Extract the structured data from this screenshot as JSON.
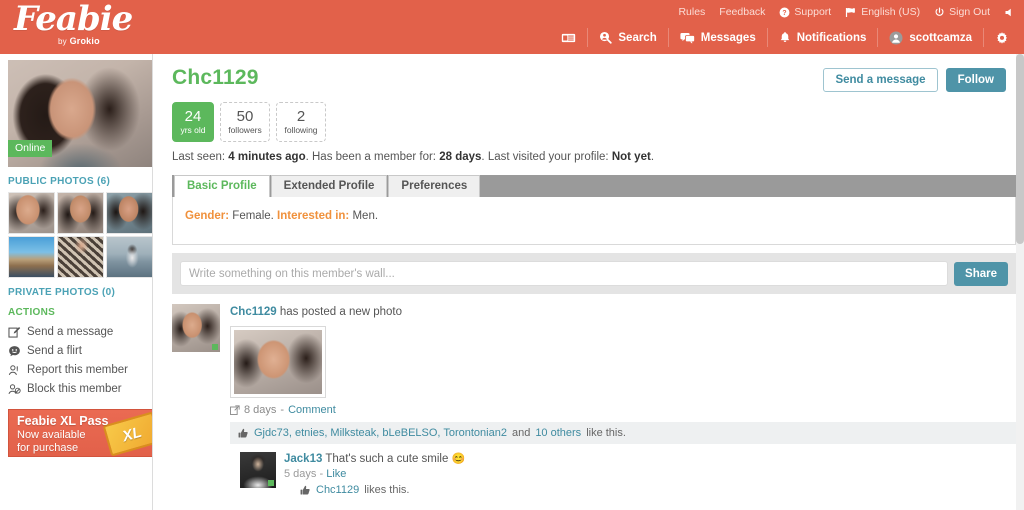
{
  "brand": {
    "name": "Feabie",
    "by": "by",
    "company": "Grokio"
  },
  "topbar": {
    "utility": [
      {
        "label": "Rules",
        "icon": ""
      },
      {
        "label": "Feedback",
        "icon": ""
      },
      {
        "label": "Support",
        "icon": "help-circle-icon"
      },
      {
        "label": "English (US)",
        "icon": "flag-icon"
      },
      {
        "label": "Sign Out",
        "icon": "power-icon"
      }
    ],
    "speaker_icon": "speaker-icon",
    "nav": [
      {
        "label": "",
        "icon": "newspaper-icon"
      },
      {
        "label": "Search",
        "icon": "search-person-icon"
      },
      {
        "label": "Messages",
        "icon": "messages-icon"
      },
      {
        "label": "Notifications",
        "icon": "bell-icon"
      },
      {
        "label": "scottcamza",
        "icon": "avatar-icon"
      },
      {
        "label": "",
        "icon": "gear-icon"
      }
    ]
  },
  "sidebar": {
    "online_badge": "Online",
    "public_photos_heading": "PUBLIC PHOTOS (6)",
    "private_photos_heading": "PRIVATE PHOTOS (0)",
    "actions_heading": "ACTIONS",
    "actions": [
      {
        "label": "Send a message",
        "icon": "compose-icon"
      },
      {
        "label": "Send a flirt",
        "icon": "smiley-icon"
      },
      {
        "label": "Report this member",
        "icon": "report-user-icon"
      },
      {
        "label": "Block this member",
        "icon": "block-user-icon"
      }
    ],
    "promo": {
      "title": "Feabie XL Pass",
      "line1": "Now available",
      "line2": "for purchase",
      "ticket_label": "XL"
    }
  },
  "profile": {
    "username": "Chc1129",
    "send_message_button": "Send a message",
    "follow_button": "Follow",
    "stats": [
      {
        "num": "24",
        "label": "yrs old",
        "highlight": true
      },
      {
        "num": "50",
        "label": "followers",
        "highlight": false
      },
      {
        "num": "2",
        "label": "following",
        "highlight": false
      }
    ],
    "status": {
      "last_seen_label": "Last seen:",
      "last_seen_value": "4 minutes ago",
      "member_for_label": "Has been a member for:",
      "member_for_value": "28 days",
      "last_visited_label": "Last visited your profile:",
      "last_visited_value": "Not yet"
    },
    "tabs": [
      {
        "label": "Basic Profile",
        "active": true
      },
      {
        "label": "Extended Profile",
        "active": false
      },
      {
        "label": "Preferences",
        "active": false
      }
    ],
    "basic": {
      "gender_label": "Gender:",
      "gender_value": "Female.",
      "interested_label": "Interested in:",
      "interested_value": "Men."
    }
  },
  "wall": {
    "placeholder": "Write something on this member's wall...",
    "share_button": "Share"
  },
  "feed": {
    "post": {
      "author": "Chc1129",
      "action_text": "has posted a new photo",
      "time": "8 days",
      "separator": "-",
      "comment_link": "Comment",
      "likes": {
        "names": "Gjdc73, etnies, Milksteak, bLeBELSO, Torontonian2",
        "and": "and",
        "others": "10 others",
        "suffix": "like this."
      },
      "comments": [
        {
          "author": "Jack13",
          "text": "That's such a cute smile",
          "emoji": "😊",
          "time": "5 days",
          "separator": "-",
          "like_link": "Like",
          "liked_by": "Chc1129",
          "liked_suffix": "likes this."
        }
      ]
    }
  },
  "colors": {
    "brand_red": "#e2614a",
    "green": "#5cb85c",
    "teal": "#4f94a8",
    "link_teal": "#3f8ba0",
    "orange_label": "#f0913c",
    "tabstrip_gray": "#9a9a9a"
  }
}
